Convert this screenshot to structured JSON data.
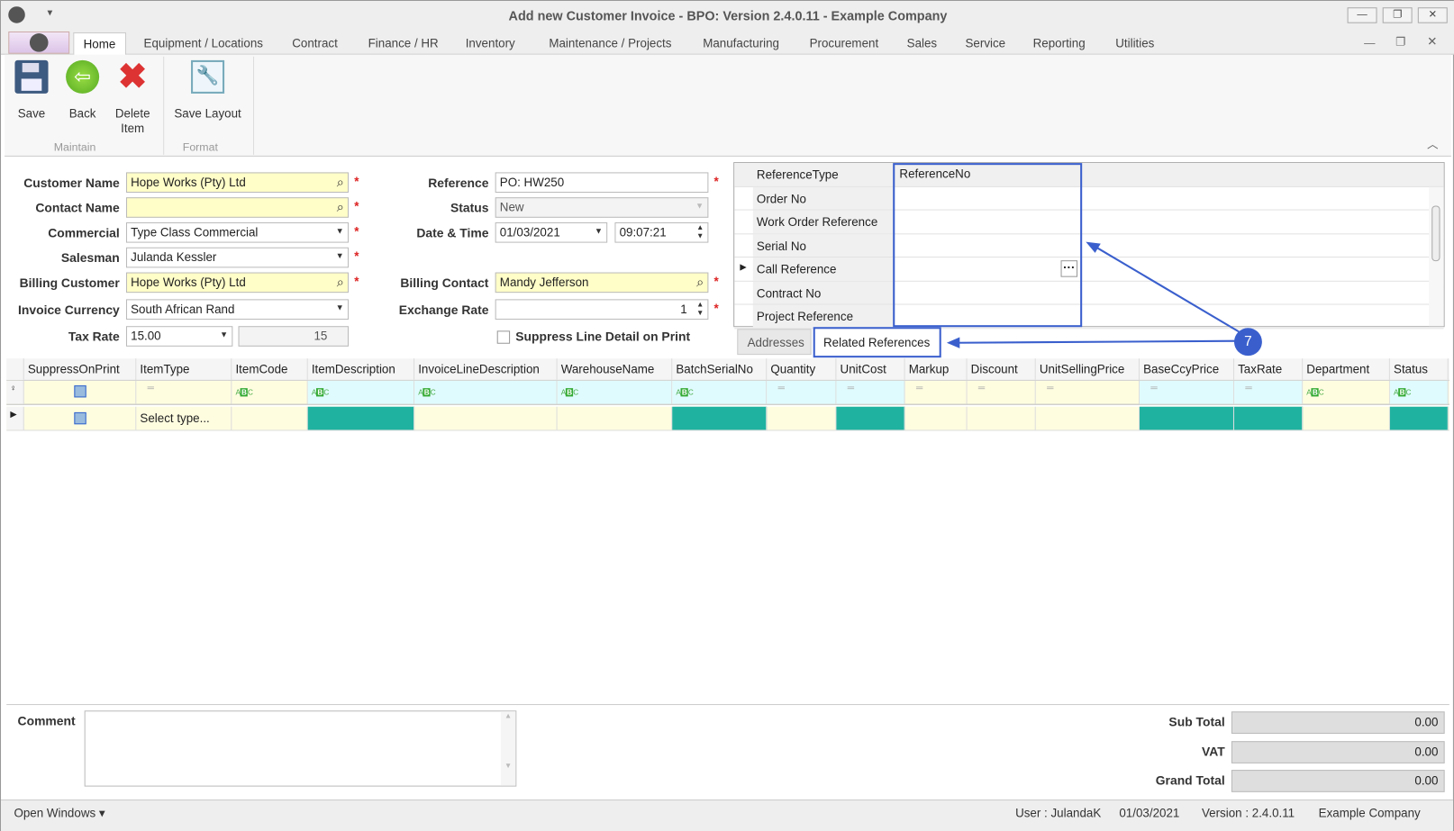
{
  "window": {
    "title": "Add new Customer Invoice - BPO: Version 2.4.0.11 - Example Company",
    "minimize": "—",
    "restore": "❐",
    "close": "✕"
  },
  "menu_tabs": [
    "Home",
    "Equipment / Locations",
    "Contract",
    "Finance / HR",
    "Inventory",
    "Maintenance / Projects",
    "Manufacturing",
    "Procurement",
    "Sales",
    "Service",
    "Reporting",
    "Utilities"
  ],
  "ribbon": {
    "save": "Save",
    "back": "Back",
    "delete_line1": "Delete",
    "delete_line2": "Item",
    "save_layout": "Save Layout",
    "group_maintain": "Maintain",
    "group_format": "Format"
  },
  "form": {
    "customer_name_label": "Customer Name",
    "customer_name": "Hope Works (Pty) Ltd",
    "contact_name_label": "Contact Name",
    "contact_name": "",
    "commercial_label": "Commercial",
    "commercial": "Type Class Commercial",
    "salesman_label": "Salesman",
    "salesman": "Julanda Kessler",
    "billing_customer_label": "Billing Customer",
    "billing_customer": "Hope Works (Pty) Ltd",
    "invoice_currency_label": "Invoice Currency",
    "invoice_currency": "South African Rand",
    "tax_rate_label": "Tax Rate",
    "tax_rate": "15.00",
    "tax_rate_value": "15",
    "reference_label": "Reference",
    "reference": "PO: HW250",
    "status_label": "Status",
    "status": "New",
    "datetime_label": "Date & Time",
    "date": "01/03/2021",
    "time": "09:07:21",
    "billing_contact_label": "Billing Contact",
    "billing_contact": "Mandy Jefferson",
    "exchange_rate_label": "Exchange Rate",
    "exchange_rate": "1",
    "suppress_label": "Suppress Line Detail on Print",
    "required": "*"
  },
  "references": {
    "col1": "ReferenceType",
    "col2": "ReferenceNo",
    "rows": [
      "Order No",
      "Work Order Reference",
      "Serial No",
      "Call Reference",
      "Contract No",
      "Project Reference"
    ],
    "ellipsis": "···",
    "tab_addresses": "Addresses",
    "tab_related": "Related References",
    "callout": "7"
  },
  "grid": {
    "columns": [
      {
        "name": "SuppressOnPrint",
        "filter": "check",
        "cell": "check"
      },
      {
        "name": "ItemType",
        "filter": "eq",
        "cell": "text"
      },
      {
        "name": "ItemCode",
        "filter": "abc",
        "cell": ""
      },
      {
        "name": "ItemDescription",
        "filter": "abc",
        "cell": "teal",
        "fc": "cyan"
      },
      {
        "name": "InvoiceLineDescription",
        "filter": "abc",
        "cell": "",
        "fc": "cyan"
      },
      {
        "name": "WarehouseName",
        "filter": "abc",
        "cell": "",
        "fc": "cyan"
      },
      {
        "name": "BatchSerialNo",
        "filter": "abc",
        "cell": "teal",
        "fc": "cyan"
      },
      {
        "name": "Quantity",
        "filter": "eq",
        "cell": "",
        "fc": "cyan"
      },
      {
        "name": "UnitCost",
        "filter": "eq",
        "cell": "teal",
        "fc": "cyan"
      },
      {
        "name": "Markup",
        "filter": "eq",
        "cell": ""
      },
      {
        "name": "Discount",
        "filter": "eq",
        "cell": ""
      },
      {
        "name": "UnitSellingPrice",
        "filter": "eq",
        "cell": ""
      },
      {
        "name": "BaseCcyPrice",
        "filter": "eq",
        "cell": "teal",
        "fc": "cyan"
      },
      {
        "name": "TaxRate",
        "filter": "eq",
        "cell": "teal",
        "fc": "cyan"
      },
      {
        "name": "Department",
        "filter": "abc",
        "cell": ""
      },
      {
        "name": "Status",
        "filter": "abc",
        "cell": "teal",
        "fc": "cyan"
      }
    ],
    "row_itemtype": "Select type..."
  },
  "footer": {
    "comment_label": "Comment",
    "subtotal_label": "Sub Total",
    "subtotal": "0.00",
    "vat_label": "VAT",
    "vat": "0.00",
    "grandtotal_label": "Grand Total",
    "grandtotal": "0.00"
  },
  "statusbar": {
    "open_windows": "Open Windows ▾",
    "user": "User : JulandaK",
    "date": "01/03/2021",
    "version": "Version : 2.4.0.11",
    "company": "Example Company"
  },
  "colors": {
    "teal": "#20b2a0",
    "highlight": "#3a5fcd",
    "yellow": "#fffdc8"
  }
}
